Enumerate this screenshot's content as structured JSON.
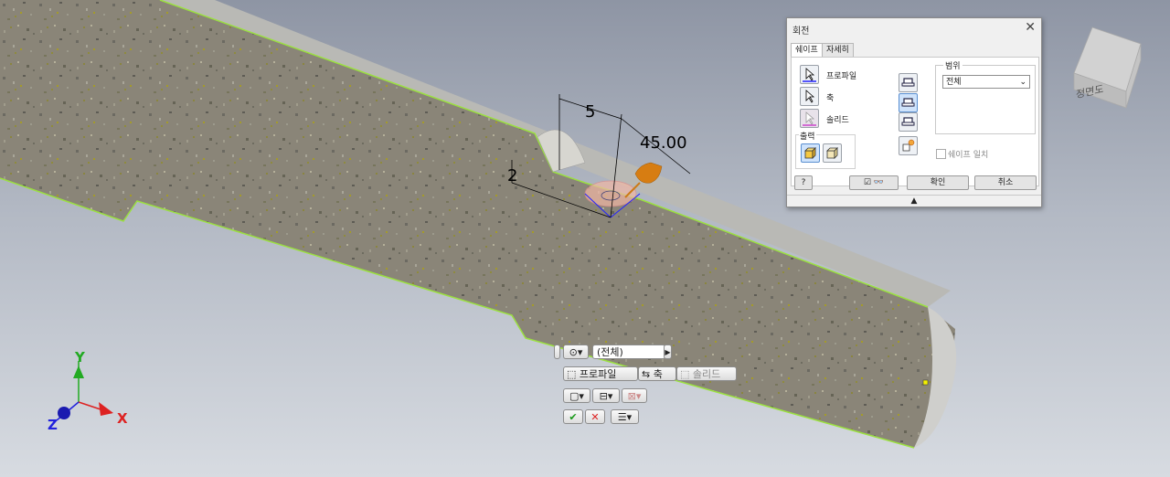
{
  "viewport": {
    "dimensions": {
      "d1": "5",
      "d2": "45.00",
      "d3": "2"
    },
    "axes": {
      "x": "X",
      "y": "Y",
      "z": "Z"
    },
    "viewcube_label": "정면도",
    "colors": {
      "body": "#8a8578",
      "edge": "#9be040",
      "top_face": "#b9b9b5"
    }
  },
  "dialog": {
    "title": "회전",
    "tabs": [
      {
        "label": "쉐이프"
      },
      {
        "label": "자세히"
      }
    ],
    "profile_label": "프로파일",
    "axis_label": "축",
    "solid_label": "솔리드",
    "output_label": "출력",
    "range_label": "범위",
    "range_value": "전체",
    "match_shape_label": "쉐이프 일치",
    "ok_label": "확인",
    "cancel_label": "취소"
  },
  "mini_toolbar": {
    "range_value": "(전체)",
    "profile_label": "프로파일",
    "axis_label": "축",
    "solid_label": "솔리드"
  }
}
